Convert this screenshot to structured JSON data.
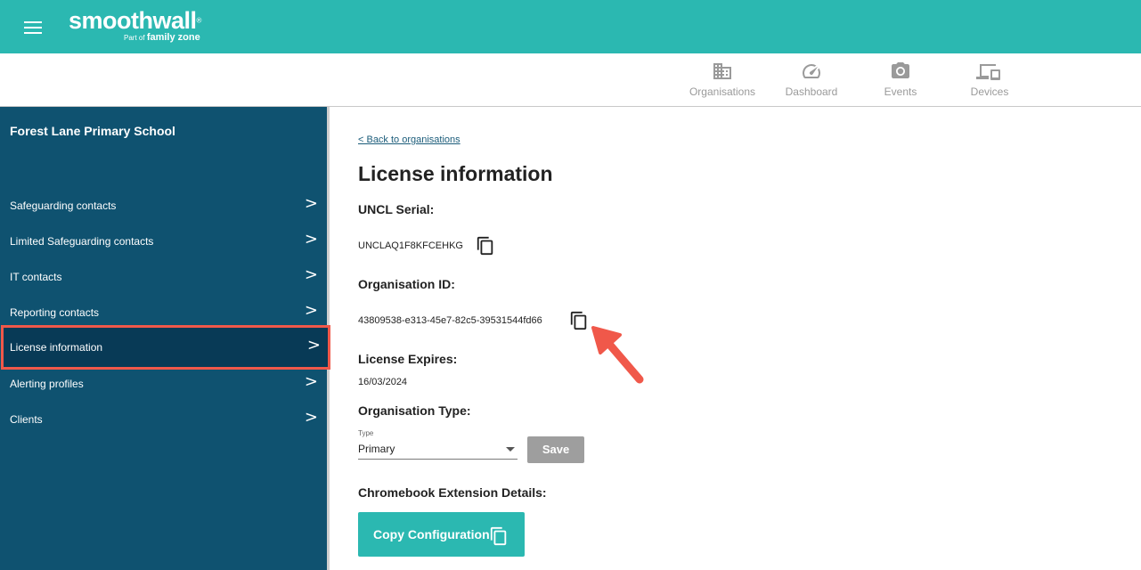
{
  "header": {
    "brand": "smoothwall",
    "brand_reg": "®",
    "sub_prefix": "Part of",
    "sub_brand": "family zone"
  },
  "nav": {
    "items": [
      {
        "label": "Organisations",
        "icon": "building-icon"
      },
      {
        "label": "Dashboard",
        "icon": "gauge-icon"
      },
      {
        "label": "Events",
        "icon": "camera-icon"
      },
      {
        "label": "Devices",
        "icon": "devices-icon"
      }
    ]
  },
  "sidebar": {
    "school": "Forest Lane Primary School",
    "items": [
      {
        "label": "Safeguarding contacts"
      },
      {
        "label": "Limited Safeguarding contacts"
      },
      {
        "label": "IT contacts"
      },
      {
        "label": "Reporting contacts"
      },
      {
        "label": "License information",
        "active": true
      },
      {
        "label": "Alerting profiles"
      },
      {
        "label": "Clients"
      }
    ],
    "chevron": ">"
  },
  "main": {
    "back_link": "< Back to organisations",
    "title": "License information",
    "uncl_label": "UNCL Serial:",
    "uncl_value": "UNCLAQ1F8KFCEHKG",
    "org_id_label": "Organisation ID:",
    "org_id_value": "43809538-e313-45e7-82c5-39531544fd66",
    "expires_label": "License Expires:",
    "expires_value": "16/03/2024",
    "org_type_label": "Organisation Type:",
    "type_caption": "Type",
    "type_value": "Primary",
    "save_label": "Save",
    "chromebook_label": "Chromebook Extension Details:",
    "copy_config_label": "Copy Configuration"
  },
  "colors": {
    "header_teal": "#2bb8b1",
    "sidebar_blue": "#0f5270",
    "active_item": "#083a56",
    "highlight_red": "#f0584a",
    "save_grey": "#9e9e9e"
  }
}
